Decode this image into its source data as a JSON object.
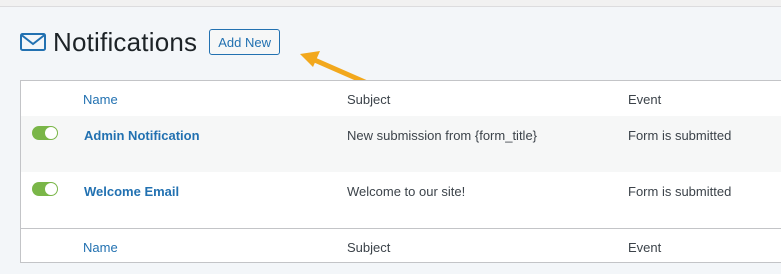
{
  "header": {
    "title": "Notifications",
    "add_new_label": "Add New",
    "icon": "mail-icon"
  },
  "table": {
    "columns": [
      "Name",
      "Subject",
      "Event"
    ],
    "rows": [
      {
        "enabled": true,
        "name": "Admin Notification",
        "subject": "New submission from {form_title}",
        "event": "Form is submitted"
      },
      {
        "enabled": true,
        "name": "Welcome Email",
        "subject": "Welcome to our site!",
        "event": "Form is submitted"
      }
    ]
  },
  "colors": {
    "link": "#2271b1",
    "toggle_on": "#7ab648",
    "arrow": "#f2a81d"
  }
}
